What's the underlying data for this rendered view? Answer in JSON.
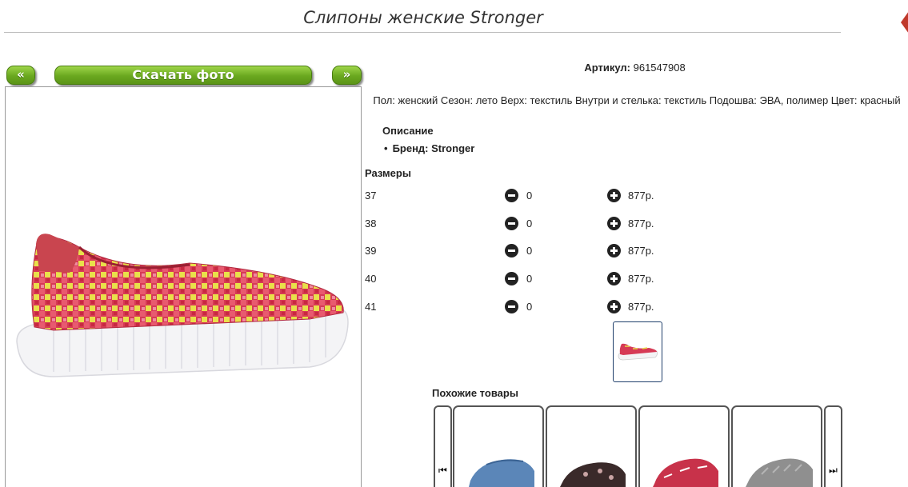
{
  "page": {
    "title": "Слипоны женские Stronger"
  },
  "toolbar": {
    "prev_label": "«",
    "download_label": "Скачать фото",
    "next_label": "»"
  },
  "product": {
    "article_label": "Артикул:",
    "article_value": "961547908",
    "attributes_text": "Пол: женский Сезон: лето Верх: текстиль Внутри и стелька: текстиль Подошва: ЭВА, полимер Цвет: красный",
    "description_heading": "Описание",
    "brand_line": "Бренд: Stronger",
    "sizes_heading": "Размеры",
    "sizes": [
      {
        "size": "37",
        "qty": "0",
        "price": "877р."
      },
      {
        "size": "38",
        "qty": "0",
        "price": "877р."
      },
      {
        "size": "39",
        "qty": "0",
        "price": "877р."
      },
      {
        "size": "40",
        "qty": "0",
        "price": "877р."
      },
      {
        "size": "41",
        "qty": "0",
        "price": "877р."
      }
    ]
  },
  "similar": {
    "heading": "Похожие товары",
    "prev_icon": "skip-back-icon",
    "next_icon": "skip-forward-icon",
    "items": [
      {
        "color": "#5b86b8"
      },
      {
        "color": "#3a2a2a"
      },
      {
        "color": "#c8324a"
      },
      {
        "color": "#8f8f8f"
      }
    ]
  },
  "colors": {
    "accent_green": "#6aa81f",
    "shoe_red": "#d63a55",
    "shoe_yellow": "#e9e04a"
  }
}
